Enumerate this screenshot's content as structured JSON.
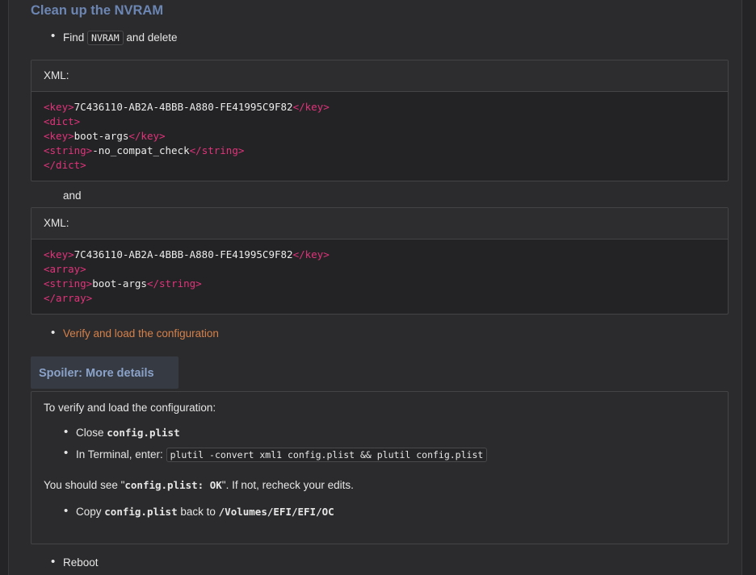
{
  "heading": "Clean up the NVRAM",
  "bullet1": {
    "text_before": "Find",
    "code": "NVRAM",
    "text_after": "and delete"
  },
  "code1": {
    "header": "XML:",
    "lines": [
      {
        "open": "<key>",
        "text": "7C436110-AB2A-4BBB-A880-FE41995C9F82",
        "close": "</key>"
      },
      {
        "open": "<dict>",
        "text": "",
        "close": ""
      },
      {
        "open": "<key>",
        "text": "boot-args",
        "close": "</key>"
      },
      {
        "open": "<string>",
        "text": "-no_compat_check",
        "close": "</string>"
      },
      {
        "open": "</dict>",
        "text": "",
        "close": ""
      }
    ]
  },
  "and_text": "and",
  "code2": {
    "header": "XML:",
    "lines": [
      {
        "open": "<key>",
        "text": "7C436110-AB2A-4BBB-A880-FE41995C9F82",
        "close": "</key>"
      },
      {
        "open": "<array>",
        "text": "",
        "close": ""
      },
      {
        "open": "<string>",
        "text": "boot-args",
        "close": "</string>"
      },
      {
        "open": "</array>",
        "text": "",
        "close": ""
      }
    ]
  },
  "bullet2_link": "Verify and load the configuration",
  "spoiler": {
    "button": "Spoiler: More details",
    "intro": "To verify and load the configuration:",
    "close_prefix": "Close",
    "close_code": "config.plist",
    "terminal_prefix": "In Terminal, enter:",
    "terminal_code": "plutil -convert xml1 config.plist && plutil config.plist",
    "see_prefix": "You should see \"",
    "see_code": "config.plist: OK",
    "see_suffix": "\". If not, recheck your edits.",
    "copy_prefix": "Copy",
    "copy_code": "config.plist",
    "copy_mid": "back to",
    "copy_path": "/Volumes/EFI/EFI/OC"
  },
  "bullet3": "Reboot"
}
